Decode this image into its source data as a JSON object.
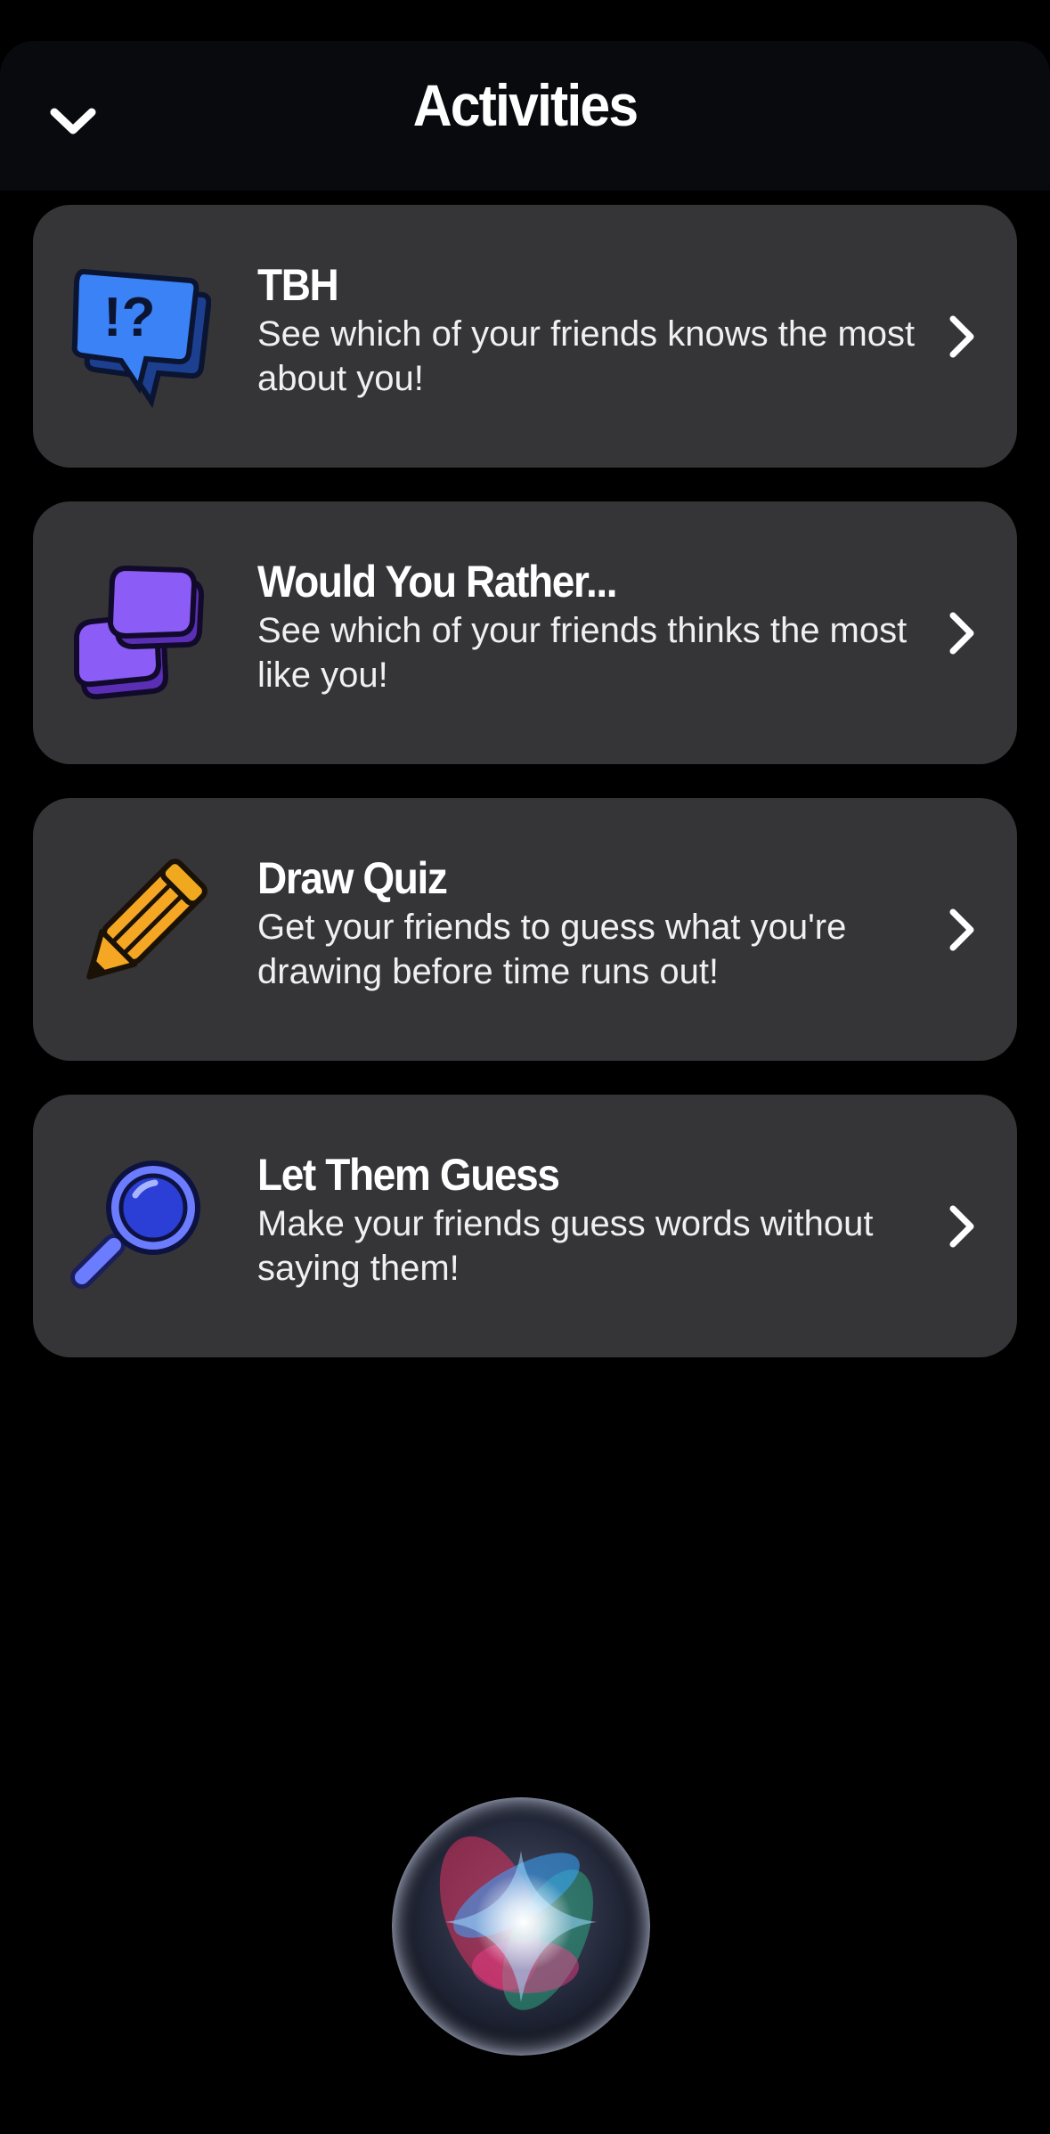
{
  "header": {
    "title": "Activities",
    "collapse_icon": "chevron-down-icon"
  },
  "activities": [
    {
      "name": "TBH",
      "description": "See which of your friends knows the most about you!",
      "icon": "speech-bubble-question-icon",
      "color": "#3b82f6"
    },
    {
      "name": "Would You Rather...",
      "description": "See which of your friends thinks the most like you!",
      "icon": "two-cards-icon",
      "color": "#8b5cf6"
    },
    {
      "name": "Draw Quiz",
      "description": "Get your friends to guess what you're drawing before time runs out!",
      "icon": "pencil-icon",
      "color": "#f5a623"
    },
    {
      "name": "Let Them Guess",
      "description": "Make your friends guess words without saying them!",
      "icon": "magnifying-glass-icon",
      "color": "#6b7cff"
    }
  ],
  "siri": {
    "icon": "siri-orb-icon"
  }
}
